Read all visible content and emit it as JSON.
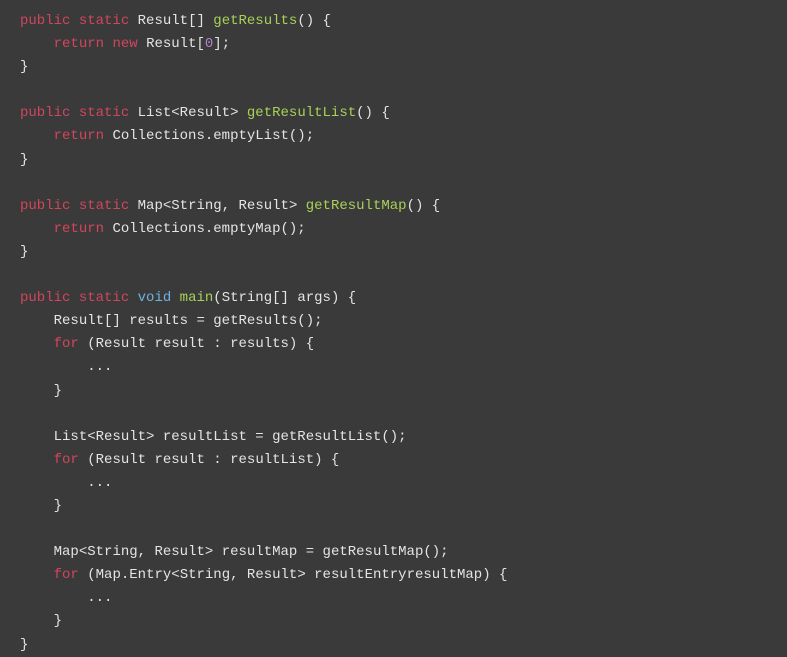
{
  "kw": {
    "public": "public",
    "static": "static",
    "return": "return",
    "new": "new",
    "void": "void",
    "for": "for"
  },
  "types": {
    "Result": "Result",
    "List": "List",
    "Map": "Map",
    "String": "String",
    "Collections": "Collections",
    "Entry": "Entry"
  },
  "methods": {
    "getResults": "getResults",
    "getResultList": "getResultList",
    "getResultMap": "getResultMap",
    "main": "main",
    "emptyList": "emptyList",
    "emptyMap": "emptyMap"
  },
  "idents": {
    "args": "args",
    "results": "results",
    "result": "result",
    "resultList": "resultList",
    "resultMap": "resultMap",
    "resultEntry": "resultEntry"
  },
  "nums": {
    "zero": "0"
  },
  "punct": {
    "ellipsis": "..."
  }
}
